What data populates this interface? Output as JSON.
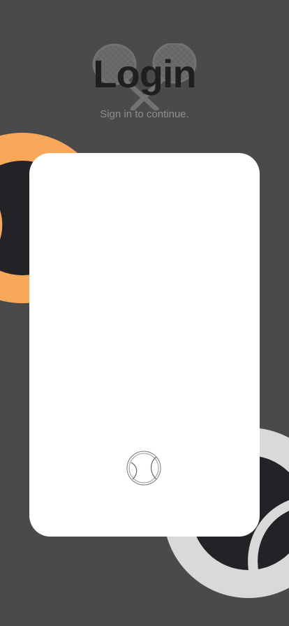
{
  "screen": {
    "title": "Login",
    "subtitle": "Sign in to continue."
  },
  "icons": {
    "background_left": "tennis-ball-icon",
    "background_right": "tennis-ball-icon",
    "title_decoration": "crossed-rackets-icon",
    "loading": "tennis-ball-icon"
  },
  "colors": {
    "background": "#4a4a4a",
    "card": "#ffffff",
    "accent_orange": "#f9a85a",
    "ball_dark": "#232327",
    "ball_light": "#d9d9d9",
    "title": "#1f1f1f",
    "subtitle": "#8e8e8e"
  }
}
